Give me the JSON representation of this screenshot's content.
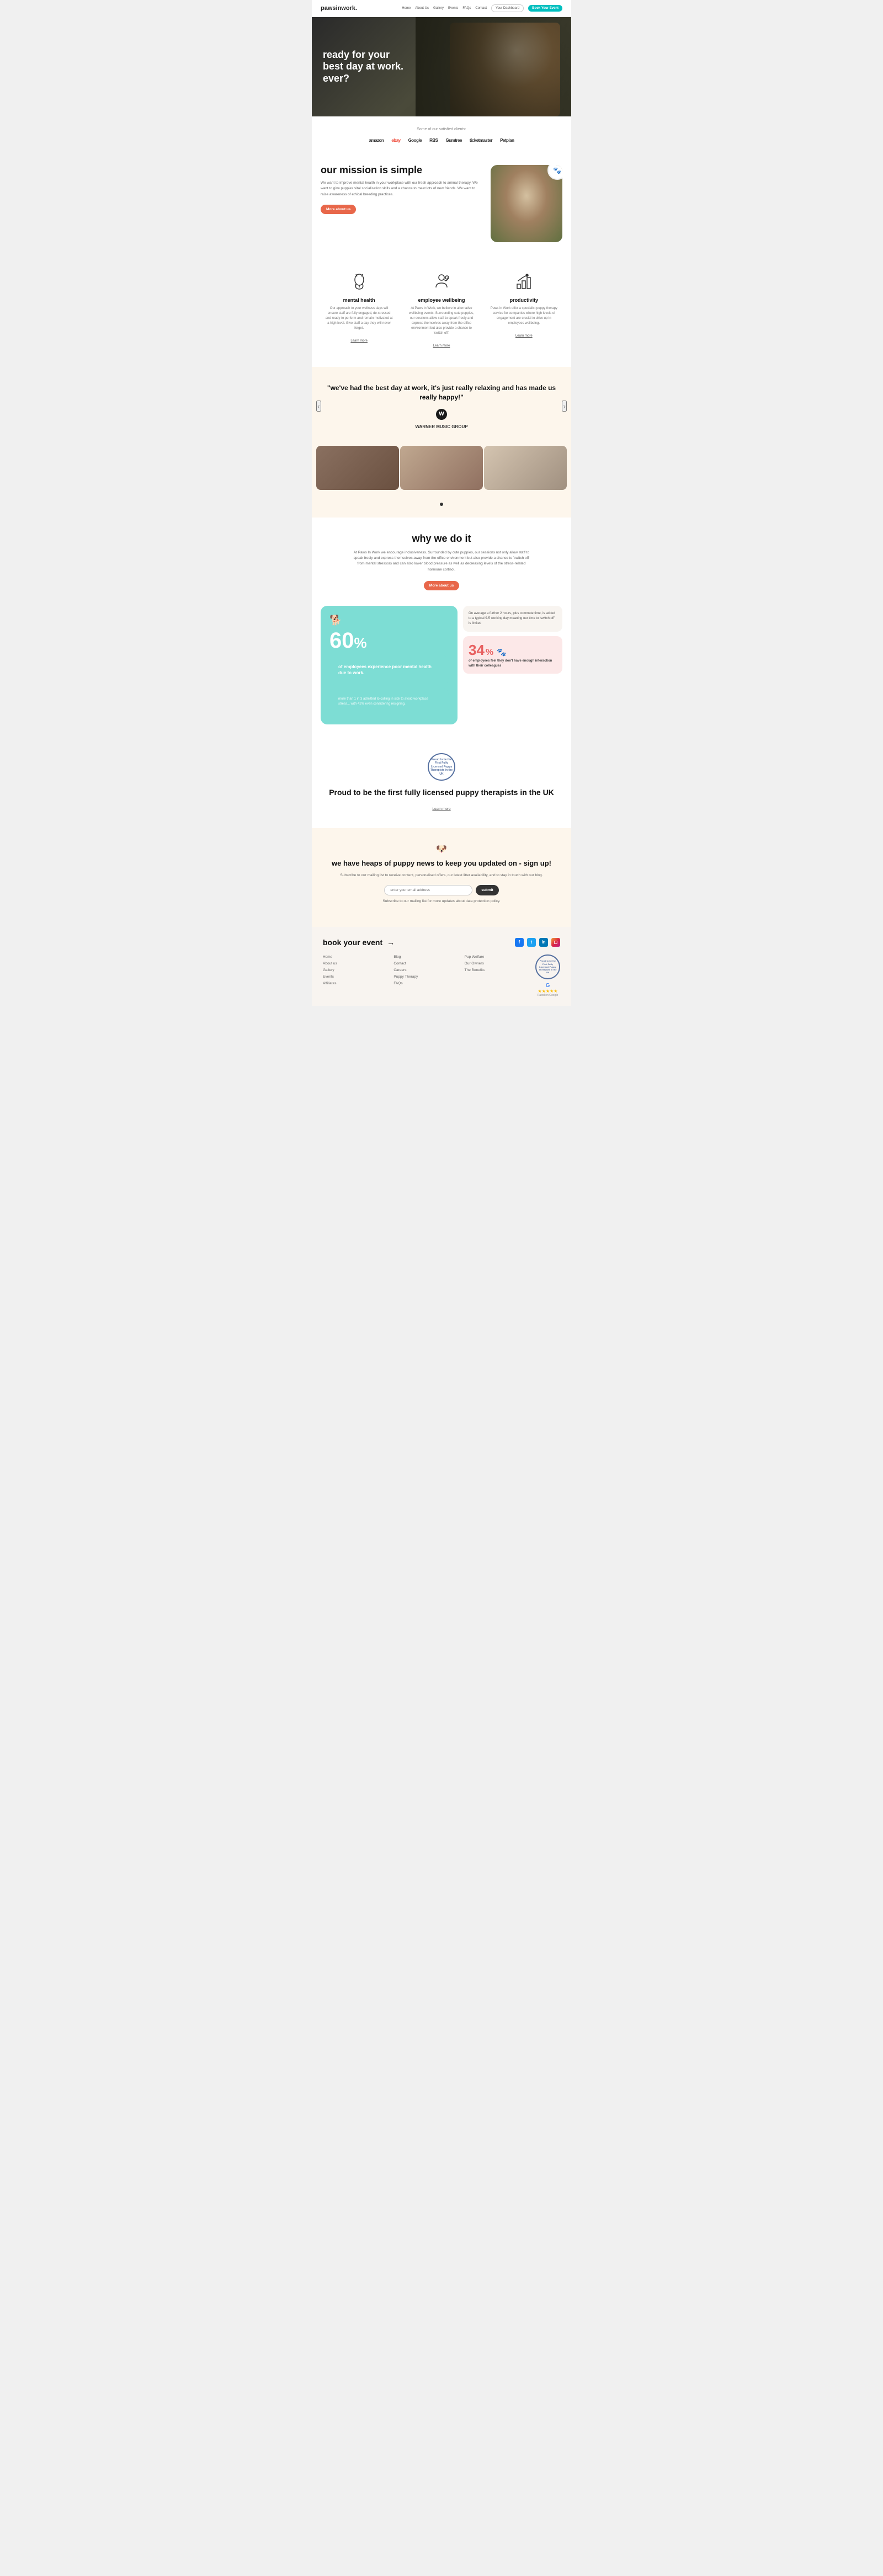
{
  "nav": {
    "logo": "pawsinwork.",
    "links": [
      "Home",
      "About Us",
      "Gallery",
      "Events",
      "FAQs",
      "Contact"
    ],
    "dashboard_btn": "Your Dashboard",
    "book_btn": "Book Your Event"
  },
  "hero": {
    "heading": "ready for your best day at work. ever?"
  },
  "clients": {
    "label": "Some of our satisfied clients:",
    "logos": [
      "amazon",
      "ebay",
      "Google",
      "RBS",
      "Gumtree",
      "ticketmaster",
      "Petplan"
    ]
  },
  "mission": {
    "heading": "our mission is simple",
    "body": "We want to improve mental health in your workplace with our fresh approach to animal therapy. We want to give puppies vital socialisation skills and a chance to meet lots of new friends. We want to raise awareness of ethical breeding practices.",
    "cta": "More about us"
  },
  "features": [
    {
      "id": "mental-health",
      "title": "mental health",
      "description": "Our approach to your wellness days will ensure staff are fully engaged, de-stressed and ready to perform and remain motivated at a high level. Give staff a day they will never forget.",
      "learn_more": "Learn more"
    },
    {
      "id": "employee-wellbeing",
      "title": "employee wellbeing",
      "description": "At Paws in Work, we believe in alternative wellbeing events. Surrounding cute puppies, our sessions allow staff to speak freely and express themselves away from the office environment but also provide a chance to 'switch off'.",
      "learn_more": "Learn more"
    },
    {
      "id": "productivity",
      "title": "productivity",
      "description": "Paws in Work offer a specialist puppy therapy service for companies where high levels of engagement are crucial to drive up in employees wellbeing.",
      "learn_more": "Learn more"
    }
  ],
  "testimonial": {
    "quote": "\"we've had the best day at work, it's just really relaxing and has made us really happy!\"",
    "company": "WARNER MUSIC GROUP"
  },
  "why": {
    "heading": "why we do it",
    "body": "At Paws In Work we encourage inclusiveness. Surrounded by cute puppies, our sessions not only allow staff to speak freely and express themselves away from the office environment but also provide a chance to 'switch off' from mental stressors and can also lower blood pressure as well as decreasing levels of the stress-related hormone cortisol.",
    "cta": "More about us"
  },
  "stats": {
    "big": {
      "number": "60",
      "percent_sign": "%",
      "label": "of employees experience poor mental health due to work.",
      "sublabel": "more than 1 in 3 admitted to calling in sick to avoid workplace stress... with 42% even considering resigning."
    },
    "small_top": {
      "text": "On average a further 2 hours, plus commute time, is added to a typical 9-5 working day meaning our time to 'switch off' is limited"
    },
    "small_bot": {
      "number": "34",
      "percent_sign": "%",
      "label": "of employees feel they don't have enough interaction with their colleagues"
    }
  },
  "licensed": {
    "badge_text": "Proud to be the First Fully Licensed Puppy Therapists in the UK",
    "heading": "Proud to be the first fully licensed puppy therapists in the UK",
    "cta": "Learn more"
  },
  "newsletter": {
    "heading": "we have heaps of puppy news to keep you updated on - sign up!",
    "body": "Subscribe to our mailing list to receive content, personalised offers, our latest litter availability, and to stay in touch with our blog.",
    "input_placeholder": "enter your email address",
    "submit": "submit",
    "disclaimer": "Subscribe to our mailing list for more updates about data protection policy."
  },
  "footer": {
    "brand": "book your event",
    "col1": {
      "links": [
        "Home",
        "About us",
        "Gallery",
        "Events",
        "Affiliates"
      ]
    },
    "col2": {
      "links": [
        "Blog",
        "Contact",
        "Careers",
        "Puppy Therapy",
        "FAQs"
      ]
    },
    "col3": {
      "links": [
        "Pup Welfare",
        "Our Owners",
        "The Benefits"
      ]
    },
    "badge_text": "Proud to be the First Fully Licensed Puppy Therapists in the UK",
    "google_label": "Google",
    "stars": "★★★★★",
    "google_rating": "Rated on Google"
  }
}
